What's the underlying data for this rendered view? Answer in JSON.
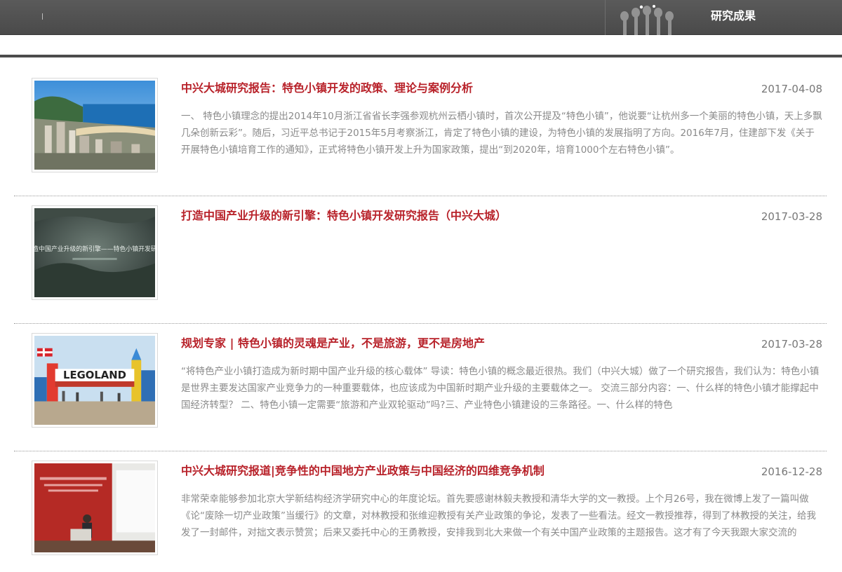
{
  "header": {
    "section_title": "研究成果"
  },
  "articles": [
    {
      "title": "中兴大城研究报告：特色小镇开发的政策、理论与案例分析",
      "date": "2017-04-08",
      "summary": "一、 特色小镇理念的提出2014年10月浙江省省长李强参观杭州云栖小镇时，首次公开提及“特色小镇”，他说要“让杭州多一个美丽的特色小镇，天上多飘几朵创新云彩”。随后，习近平总书记于2015年5月考察浙江，肯定了特色小镇的建设，为特色小镇的发展指明了方向。2016年7月，住建部下发《关于开展特色小镇培育工作的通知》，正式将特色小镇开发上升为国家政策，提出“到2020年，培育1000个左右特色小镇”。",
      "thumbnail_caption": ""
    },
    {
      "title": "打造中国产业升级的新引擎：特色小镇开发研究报告（中兴大城）",
      "date": "2017-03-28",
      "summary": "",
      "thumbnail_caption": "打造中国产业升级的新引擎——特色小镇开发研究"
    },
    {
      "title": "规划专家 | 特色小镇的灵魂是产业，不是旅游，更不是房地产",
      "date": "2017-03-28",
      "summary": "“将特色产业小镇打造成为新时期中国产业升级的核心载体” 导读：特色小镇的概念最近很热。我们（中兴大城）做了一个研究报告，我们认为：特色小镇是世界主要发达国家产业竞争力的一种重要载体，也应该成为中国新时期产业升级的主要载体之一。 交流三部分内容：一、什么样的特色小镇才能撑起中国经济转型？ 二、特色小镇一定需要“旅游和产业双轮驱动”吗?三、产业特色小镇建设的三条路径。一、什么样的特色",
      "thumbnail_caption": "LEGOLAND"
    },
    {
      "title": "中兴大城研究报道|竞争性的中国地方产业政策与中国经济的四维竞争机制",
      "date": "2016-12-28",
      "summary": "非常荣幸能够参加北京大学新结构经济学研究中心的年度论坛。首先要感谢林毅夫教授和清华大学的文一教授。上个月26号，我在微博上发了一篇叫做《论“废除一切产业政策”当缓行》的文章，对林教授和张维迎教授有关产业政策的争论，发表了一些看法。经文一教授推荐，得到了林教授的关注，给我发了一封邮件，对拙文表示赞赏；后来又委托中心的王勇教授，安排我到北大来做一个有关中国产业政策的主题报告。这才有了今天我跟大家交流的",
      "thumbnail_caption": ""
    }
  ]
}
